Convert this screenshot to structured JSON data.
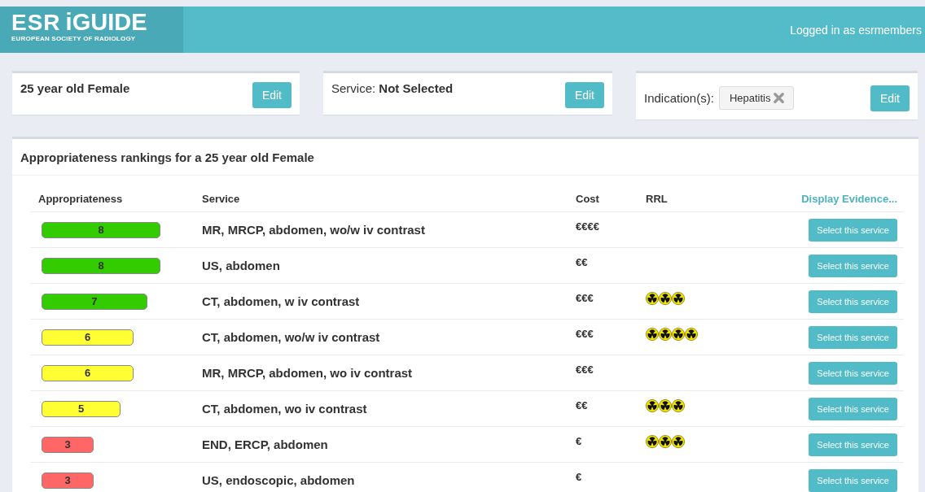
{
  "header": {
    "logo_mark": "ESR",
    "logo_name": "iGUIDE",
    "logo_subtitle": "EUROPEAN SOCIETY OF RADIOLOGY",
    "user_text": "Logged in as esrmembers"
  },
  "cards": [
    {
      "kind": "patient",
      "text": "25 year old Female",
      "button": "Edit"
    },
    {
      "kind": "service",
      "label": "Service:",
      "value": "Not Selected",
      "button": "Edit"
    },
    {
      "kind": "indication",
      "label": "Indication(s):",
      "tags": [
        "Hepatitis"
      ],
      "button": "Edit"
    }
  ],
  "rankings": {
    "title": "Appropriateness rankings for a 25 year old Female",
    "columns": [
      "Appropriateness",
      "Service",
      "Cost",
      "RRL"
    ],
    "evidence_link": "Display Evidence...",
    "rows": [
      {
        "score": "8",
        "color": "#33cc00",
        "service": "MR, MRCP, abdomen, wo/w iv contrast",
        "cost": "€€€€",
        "button": "Select this service"
      },
      {
        "score": "8",
        "color": "#33cc00",
        "service": "US, abdomen",
        "cost": "€€",
        "button": "Select this service"
      },
      {
        "score": "7",
        "color": "#33cc00",
        "service": "CT, abdomen, w iv contrast",
        "cost": "€€€",
        "stars": 3,
        "button": "Select this service"
      },
      {
        "score": "6",
        "color": "#ffff33",
        "service": "CT, abdomen, wo/w iv contrast",
        "cost": "€€€",
        "stars": 4,
        "button": "Select this service"
      },
      {
        "score": "6",
        "color": "#ffff33",
        "service": "MR, MRCP, abdomen, wo iv contrast",
        "cost": "€€€",
        "button": "Select this service"
      },
      {
        "score": "5",
        "color": "#ffff33",
        "service": "CT, abdomen, wo iv contrast",
        "cost": "€€",
        "stars": 3,
        "button": "Select this service"
      },
      {
        "score": "3",
        "color": "#ff6666",
        "service": "END, ERCP, abdomen",
        "cost": "€",
        "stars": 3,
        "button": "Select this service"
      },
      {
        "score": "3",
        "color": "#ff6666",
        "service": "US, endoscopic, abdomen",
        "cost": "€",
        "button": "Select this service"
      }
    ]
  }
}
